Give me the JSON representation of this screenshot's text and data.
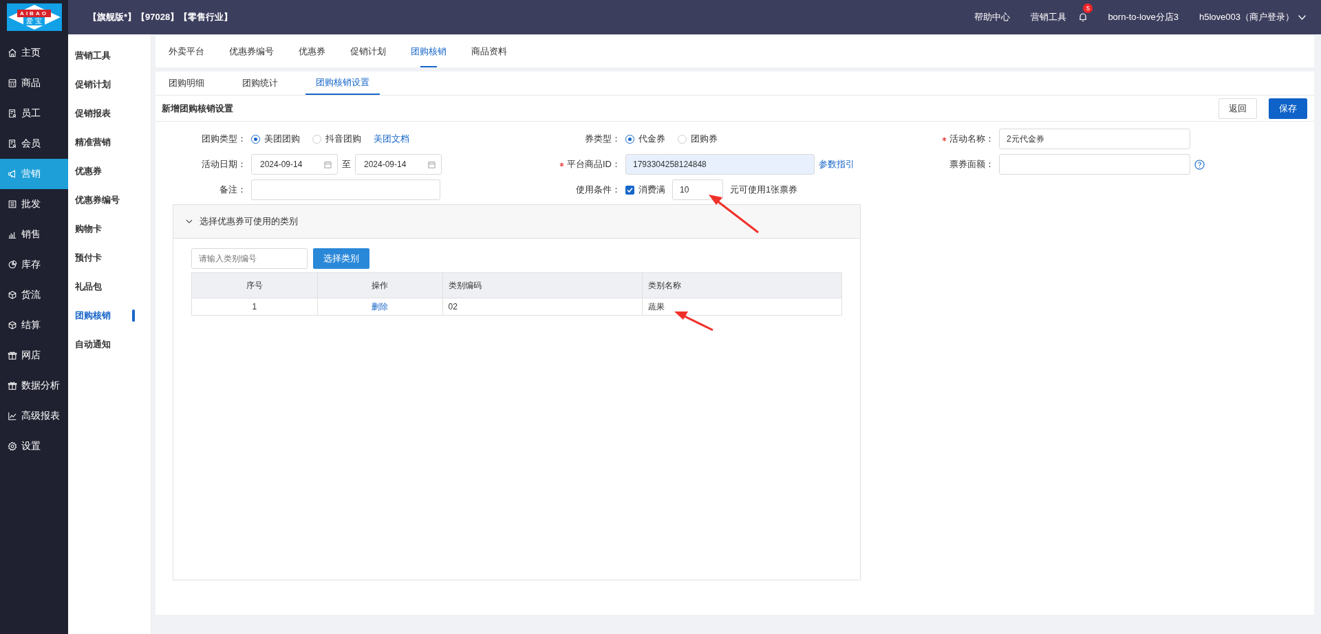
{
  "logo": {
    "text": "AIBAO",
    "subtext": "爱 宝"
  },
  "header": {
    "title": "【旗舰版*】【97028】【零售行业】",
    "links": [
      "帮助中心",
      "营销工具"
    ],
    "notification_badge": "5",
    "store": "born-to-love分店3",
    "user": "h5love003（商户登录）"
  },
  "nav": [
    {
      "label": "主页",
      "selected": false
    },
    {
      "label": "商品",
      "selected": false
    },
    {
      "label": "员工",
      "selected": false
    },
    {
      "label": "会员",
      "selected": false
    },
    {
      "label": "营销",
      "selected": true
    },
    {
      "label": "批发",
      "selected": false
    },
    {
      "label": "销售",
      "selected": false
    },
    {
      "label": "库存",
      "selected": false
    },
    {
      "label": "货流",
      "selected": false
    },
    {
      "label": "结算",
      "selected": false
    },
    {
      "label": "网店",
      "selected": false
    },
    {
      "label": "数据分析",
      "selected": false
    },
    {
      "label": "高级报表",
      "selected": false
    },
    {
      "label": "设置",
      "selected": false
    }
  ],
  "subnav": [
    {
      "label": "营销工具",
      "selected": false
    },
    {
      "label": "促销计划",
      "selected": false
    },
    {
      "label": "促销报表",
      "selected": false
    },
    {
      "label": "精准营销",
      "selected": false
    },
    {
      "label": "优惠券",
      "selected": false
    },
    {
      "label": "优惠券编号",
      "selected": false
    },
    {
      "label": "购物卡",
      "selected": false
    },
    {
      "label": "预付卡",
      "selected": false
    },
    {
      "label": "礼品包",
      "selected": false
    },
    {
      "label": "团购核销",
      "selected": true
    },
    {
      "label": "自动通知",
      "selected": false
    }
  ],
  "top_tabs": [
    {
      "label": "外卖平台",
      "selected": false
    },
    {
      "label": "优惠券编号",
      "selected": false
    },
    {
      "label": "优惠券",
      "selected": false
    },
    {
      "label": "促销计划",
      "selected": false
    },
    {
      "label": "团购核销",
      "selected": true
    },
    {
      "label": "商品资料",
      "selected": false
    }
  ],
  "sub_tabs": [
    {
      "label": "团购明细",
      "selected": false
    },
    {
      "label": "团购统计",
      "selected": false
    },
    {
      "label": "团购核销设置",
      "selected": true
    }
  ],
  "form": {
    "title": "新增团购核销设置",
    "buttons": [
      {
        "label": "返回",
        "kind": "secondary"
      },
      {
        "label": "保存",
        "kind": "primary"
      }
    ],
    "group_type": {
      "label": "团购类型：",
      "required": false,
      "options": [
        {
          "label": "美团团购",
          "selected": true
        },
        {
          "label": "抖音团购",
          "selected": false
        }
      ],
      "link": "美团文档"
    },
    "coupon_type": {
      "label": "券类型：",
      "required": false,
      "options": [
        {
          "label": "代金券",
          "selected": true
        },
        {
          "label": "团购券",
          "selected": false
        }
      ]
    },
    "activity_name": {
      "label": "活动名称：",
      "required": true,
      "value": "2元代金券"
    },
    "activity_date": {
      "label": "活动日期：",
      "required": false,
      "start": "2024-09-14",
      "separator": "至",
      "end": "2024-09-14"
    },
    "platform_id": {
      "label": "平台商品ID：",
      "required": true,
      "value": "1793304258124848",
      "link": "参数指引"
    },
    "face_value": {
      "label": "票券面额：",
      "required": false
    },
    "remark": {
      "label": "备注：",
      "required": false
    },
    "usage": {
      "label": "使用条件：",
      "required": false,
      "checkbox": {
        "label": "消费满",
        "checked": true
      },
      "value": "10",
      "suffix": "元可使用1张票券"
    }
  },
  "panel": {
    "title": "选择优惠券可使用的类别",
    "expanded": true,
    "search_placeholder": "请输入类别编号",
    "button": "选择类别",
    "table": {
      "columns": [
        "序号",
        "操作",
        "类别编码",
        "类别名称"
      ],
      "rows": [
        {
          "index": "1",
          "action": "删除",
          "code": "02",
          "name": "蔬果"
        }
      ]
    }
  }
}
